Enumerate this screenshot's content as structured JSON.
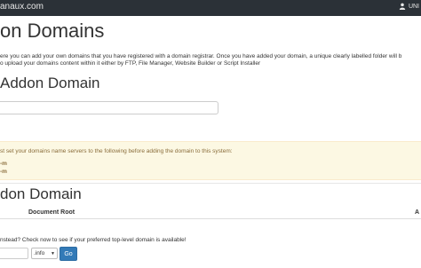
{
  "header": {
    "brand": "anaux.com",
    "user": "UNI"
  },
  "page": {
    "title": "on Domains",
    "intro_line1": "ere you can add your own domains that you have registered with a domain registrar. Once you have added your domain, a unique clearly labelled folder will b",
    "intro_line2": "o upload your domains content within it either by FTP, File Manager, Website Builder or Script Installer"
  },
  "create": {
    "title": "Addon Domain",
    "input_value": ""
  },
  "notice": {
    "text": "st set your domains name servers to the following before adding the domain to this system:",
    "ns1": "-m",
    "ns2": "-m"
  },
  "list": {
    "title": "don Domain",
    "col_document_root": "Document Root",
    "col_action": "A"
  },
  "check": {
    "text": "nstead? Check now to see if your preferred top-level domain is available!",
    "tld_selected": ".info",
    "go_label": "Go"
  }
}
